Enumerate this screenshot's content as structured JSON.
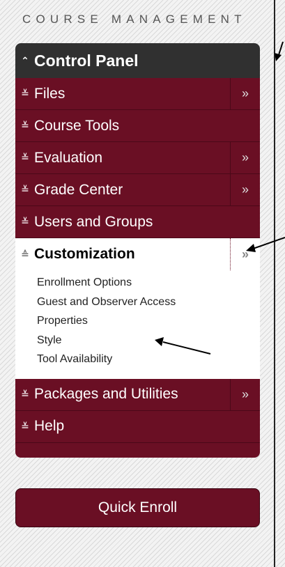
{
  "header": {
    "title": "COURSE MANAGEMENT"
  },
  "panel": {
    "title": "Control Panel",
    "items": [
      {
        "label": "Files",
        "has_more": true
      },
      {
        "label": "Course Tools",
        "has_more": false
      },
      {
        "label": "Evaluation",
        "has_more": true
      },
      {
        "label": "Grade Center",
        "has_more": true
      },
      {
        "label": "Users and Groups",
        "has_more": false
      },
      {
        "label": "Customization",
        "has_more": true,
        "expanded": true,
        "subitems": [
          "Enrollment Options",
          "Guest and Observer Access",
          "Properties",
          "Style",
          "Tool Availability"
        ]
      },
      {
        "label": "Packages and Utilities",
        "has_more": true
      },
      {
        "label": "Help",
        "has_more": false
      }
    ]
  },
  "quick_enroll": {
    "label": "Quick Enroll"
  },
  "glyphs": {
    "collapsed": "≚",
    "expanded": "≙",
    "more": "»"
  }
}
